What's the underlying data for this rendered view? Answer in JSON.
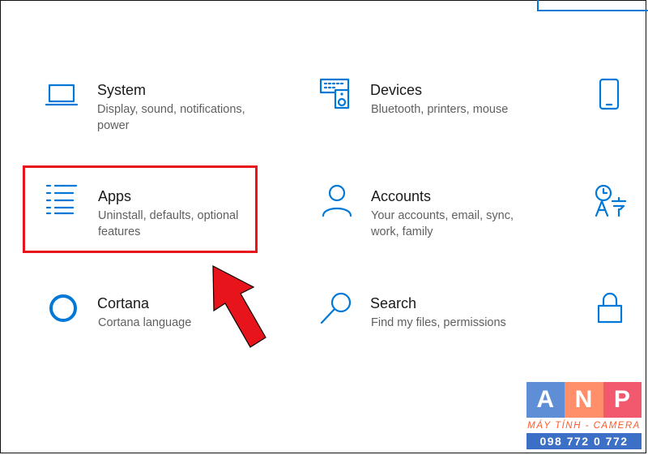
{
  "tiles": {
    "system": {
      "title": "System",
      "desc": "Display, sound, notifications,\npower"
    },
    "devices": {
      "title": "Devices",
      "desc": "Bluetooth, printers, mouse"
    },
    "apps": {
      "title": "Apps",
      "desc": "Uninstall, defaults, optional\nfeatures"
    },
    "accounts": {
      "title": "Accounts",
      "desc": "Your accounts, email, sync,\nwork, family"
    },
    "cortana": {
      "title": "Cortana",
      "desc": "Cortana language"
    },
    "search": {
      "title": "Search",
      "desc": "Find my files, permissions"
    }
  },
  "icons": {
    "system": "laptop-icon",
    "devices": "keyboard-speaker-icon",
    "phone": "phone-icon",
    "apps": "list-icon",
    "accounts": "person-icon",
    "time_language": "time-language-icon",
    "cortana": "circle-icon",
    "search": "magnifier-icon",
    "privacy": "lock-icon"
  },
  "logo": {
    "letters": [
      "A",
      "N",
      "P"
    ],
    "colors": [
      "#5e8fd6",
      "#ff8f6b",
      "#f2586e"
    ],
    "tagline": "MÁY TÍNH - CAMERA",
    "phone": "098 772 0 772"
  },
  "colors": {
    "accent": "#0078d7",
    "highlight": "#e8141c"
  }
}
